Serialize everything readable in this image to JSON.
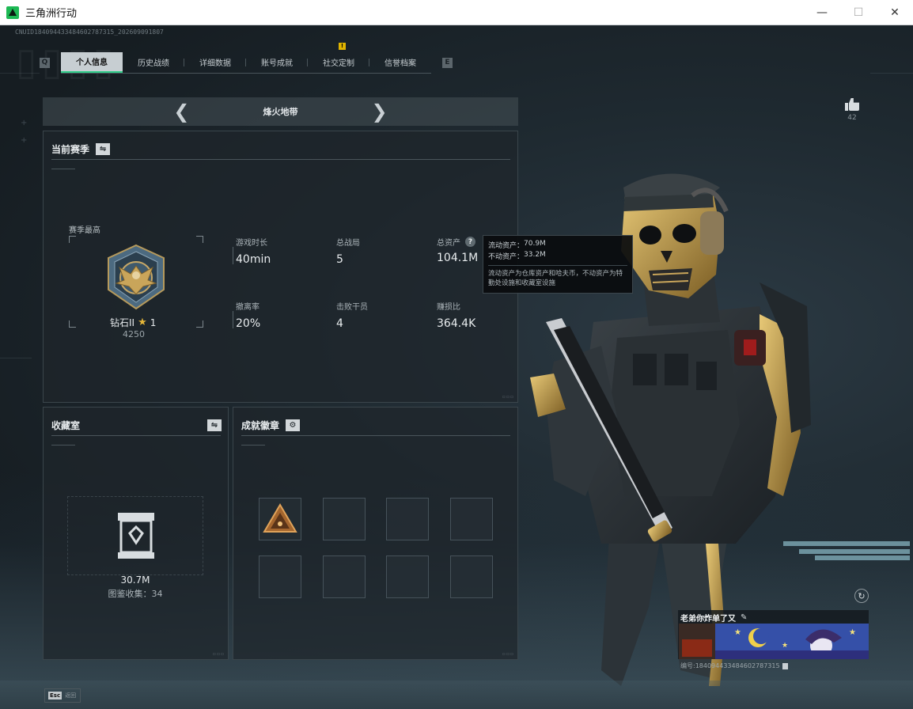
{
  "window": {
    "title": "三角洲行动",
    "minimize": "—",
    "maximize": "☐",
    "close": "✕"
  },
  "header": {
    "cnuid": "CNUID184094433484602787315_202609091807"
  },
  "tabs": [
    {
      "label": "个人信息",
      "active": true
    },
    {
      "label": "历史战绩"
    },
    {
      "label": "详细数据"
    },
    {
      "label": "账号成就"
    },
    {
      "label": "社交定制",
      "badge": "!"
    },
    {
      "label": "信誉档案"
    }
  ],
  "tab_prev_key": "Q",
  "tab_next_key": "E",
  "like": {
    "count": "42",
    "icon": "thumbs-up-icon"
  },
  "map_selector": {
    "name": "烽火地带",
    "prev": "❮",
    "next": "❯"
  },
  "season_panel": {
    "title": "当前赛季",
    "rank_label": "赛季最高",
    "rank_name": "钻石II",
    "rank_stars": "1",
    "rank_score": "4250",
    "stats": [
      {
        "label": "游戏时长",
        "value": "40min"
      },
      {
        "label": "总战局",
        "value": "5"
      },
      {
        "label": "总资产",
        "value": "104.1M",
        "has_help": true
      },
      {
        "label": "撤离率",
        "value": "20%"
      },
      {
        "label": "击败干员",
        "value": "4"
      },
      {
        "label": "赚损比",
        "value": "364.4K"
      }
    ]
  },
  "tooltip": {
    "liquid_label": "流动资产：",
    "liquid_value": "70.9M",
    "fixed_label": "不动资产：",
    "fixed_value": "33.2M",
    "description": "流动资产为仓库资产和哈夫币，不动资产为特勤处设施和收藏室设施"
  },
  "collection_panel": {
    "title": "收藏室",
    "value": "30.7M",
    "count_text": "图鉴收集：34"
  },
  "badges_panel": {
    "title": "成就徽章",
    "slots": 8
  },
  "player_card": {
    "name": "老弟你炸单了又",
    "id_text": "编号:184094433484602787315"
  },
  "footer": {
    "esc_key": "Esc",
    "esc_label": "返回"
  },
  "colors": {
    "accent": "#2fcc88",
    "gold": "#e4b63a",
    "badge": "#e0b400"
  }
}
